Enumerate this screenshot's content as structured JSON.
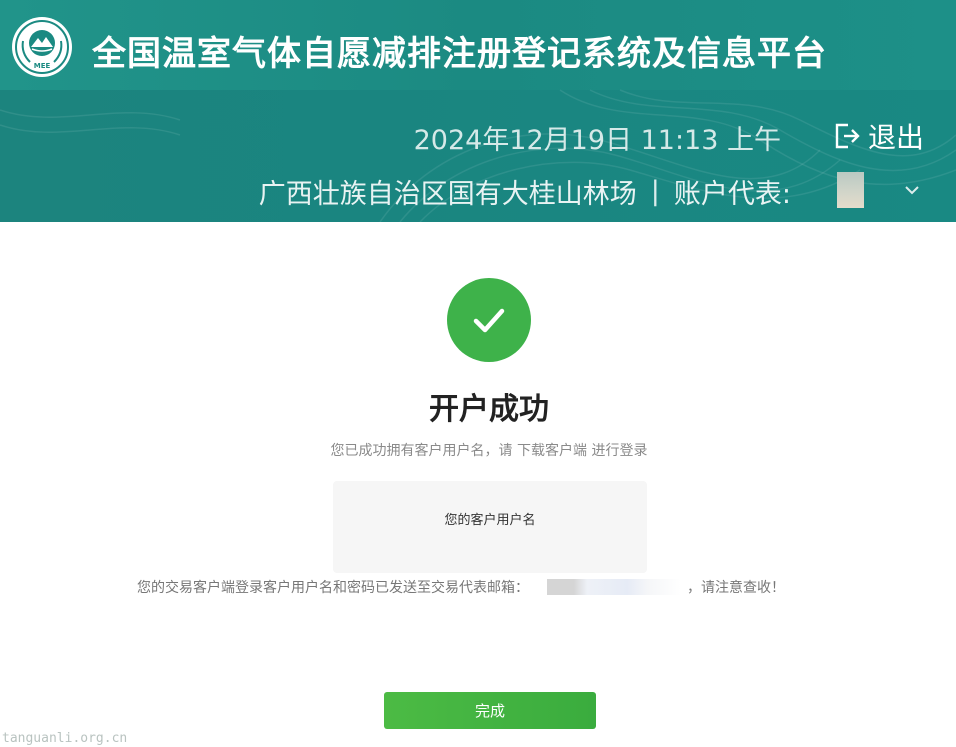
{
  "header": {
    "title": "全国温室气体自愿减排注册登记系统及信息平台",
    "logo_text": "MEE",
    "datetime": "2024年12月19日 11:13 上午",
    "logout_label": "退出",
    "organization": "广西壮族自治区国有大桂山林场",
    "separator": "|",
    "account_rep_label": "账户代表:"
  },
  "main": {
    "title": "开户成功",
    "subtitle": "您已成功拥有客户用户名，请 下载客户端 进行登录",
    "username_box_label": "您的客户用户名",
    "email_notice_prefix": "您的交易客户端登录客户用户名和密码已发送至交易代表邮箱：",
    "email_notice_suffix": "，请注意查收！",
    "done_button": "完成"
  },
  "watermark": "tanguanli.org.cn",
  "colors": {
    "header_teal": "#1b8a82",
    "success_green": "#3eb24a",
    "button_green": "#3aac3e"
  }
}
